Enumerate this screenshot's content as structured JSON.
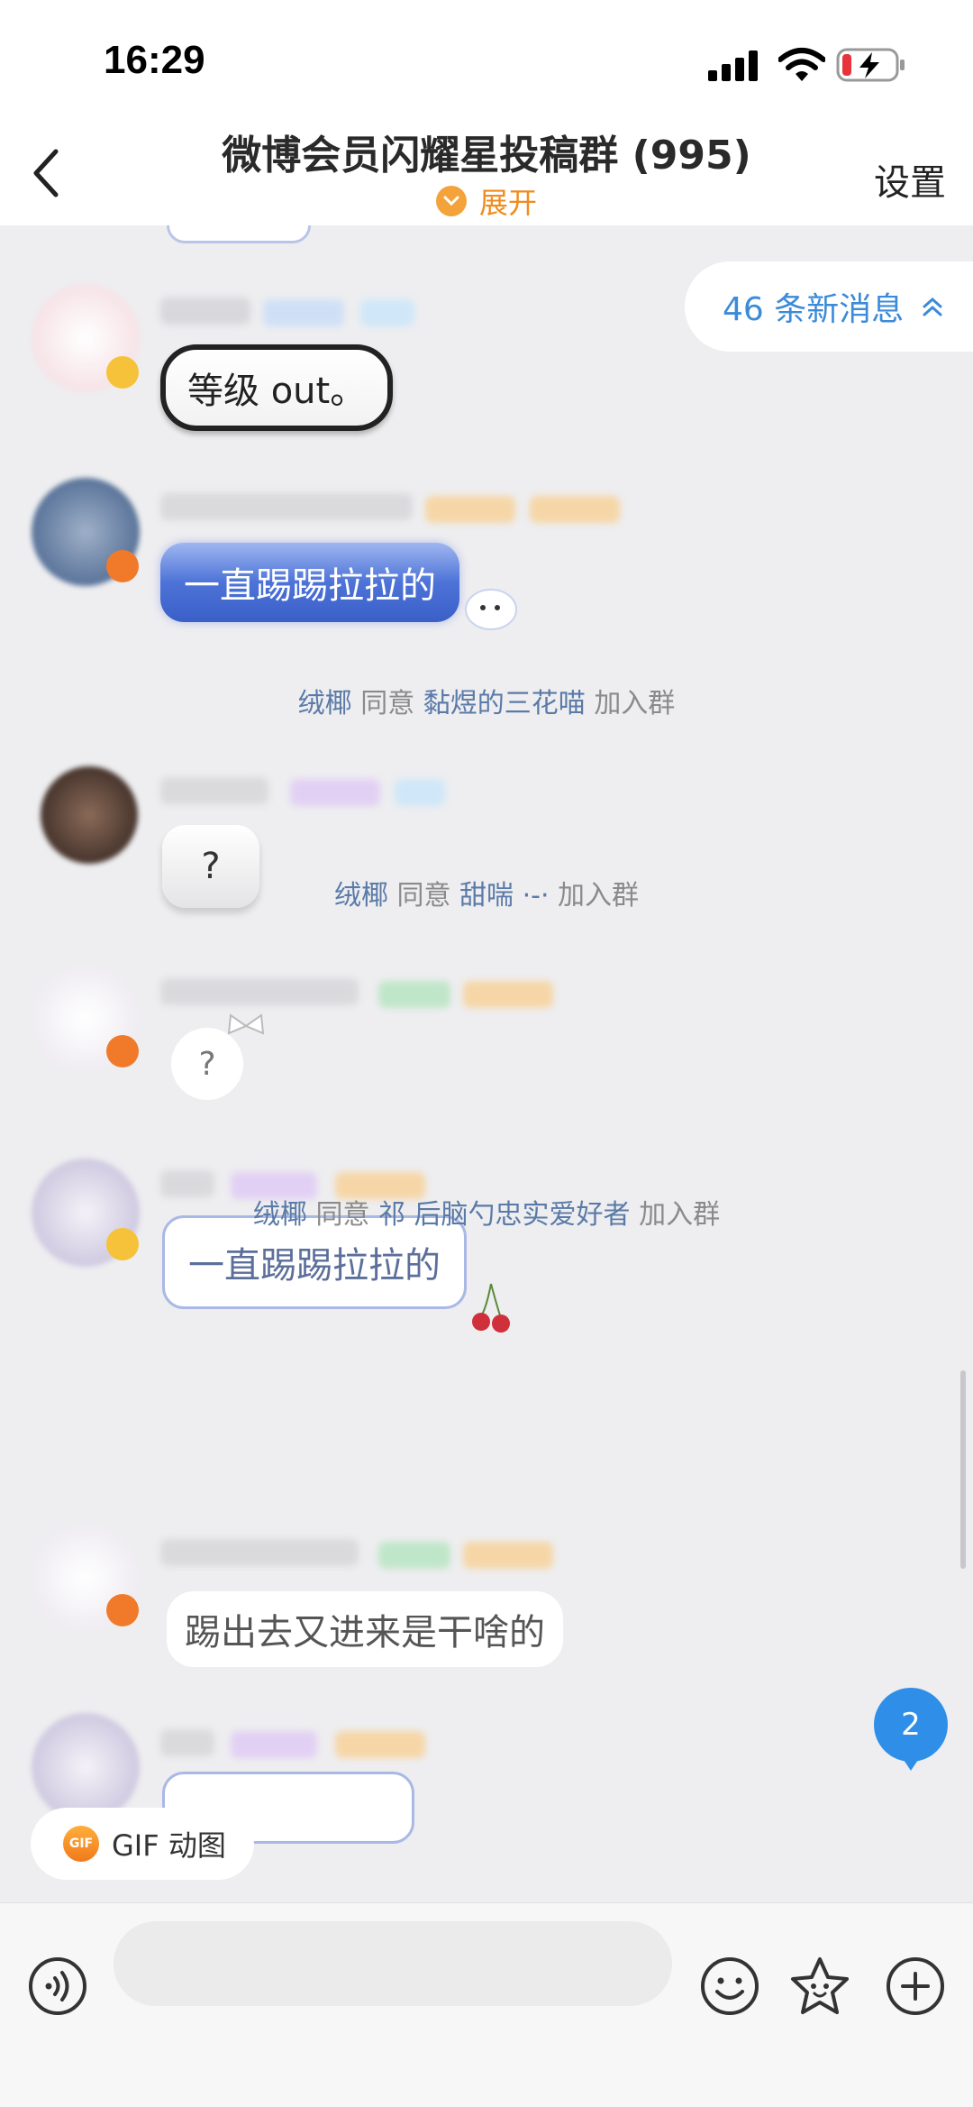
{
  "status_bar": {
    "time": "16:29"
  },
  "header": {
    "title": "微博会员闪耀星投稿群 (995)",
    "expand_label": "展开",
    "settings_label": "设置"
  },
  "new_messages": {
    "label": "46 条新消息"
  },
  "messages": [
    {
      "text": "等级 out。",
      "style": "dark-outline"
    },
    {
      "text": "一直踢踢拉拉的",
      "style": "blue-gradient"
    },
    {
      "text": "?",
      "style": "grey-square"
    },
    {
      "text": "?",
      "style": "white-round"
    },
    {
      "text": "一直踢踢拉拉的",
      "style": "blue-frame"
    },
    {
      "text": "踢出去又进来是干啥的",
      "style": "white-ribbon"
    }
  ],
  "system_messages": [
    {
      "approver": "绒椰",
      "action": "同意",
      "member": "黏煜的三花喵",
      "suffix": "加入群"
    },
    {
      "approver": "绒椰",
      "action": "同意",
      "member": "甜喘 ·-·",
      "suffix": "加入群"
    },
    {
      "approver": "绒椰",
      "action": "同意",
      "member": "祁  后脑勺忠实爱好者",
      "suffix": "加入群"
    }
  ],
  "unread_badge": "2",
  "gif_chip": {
    "icon_text": "GIF",
    "label": "GIF 动图"
  },
  "input": {
    "placeholder": ""
  },
  "colors": {
    "accent_blue": "#2f8fe8",
    "expand_orange": "#f08c1c",
    "member_name": "#5a7aa8"
  }
}
